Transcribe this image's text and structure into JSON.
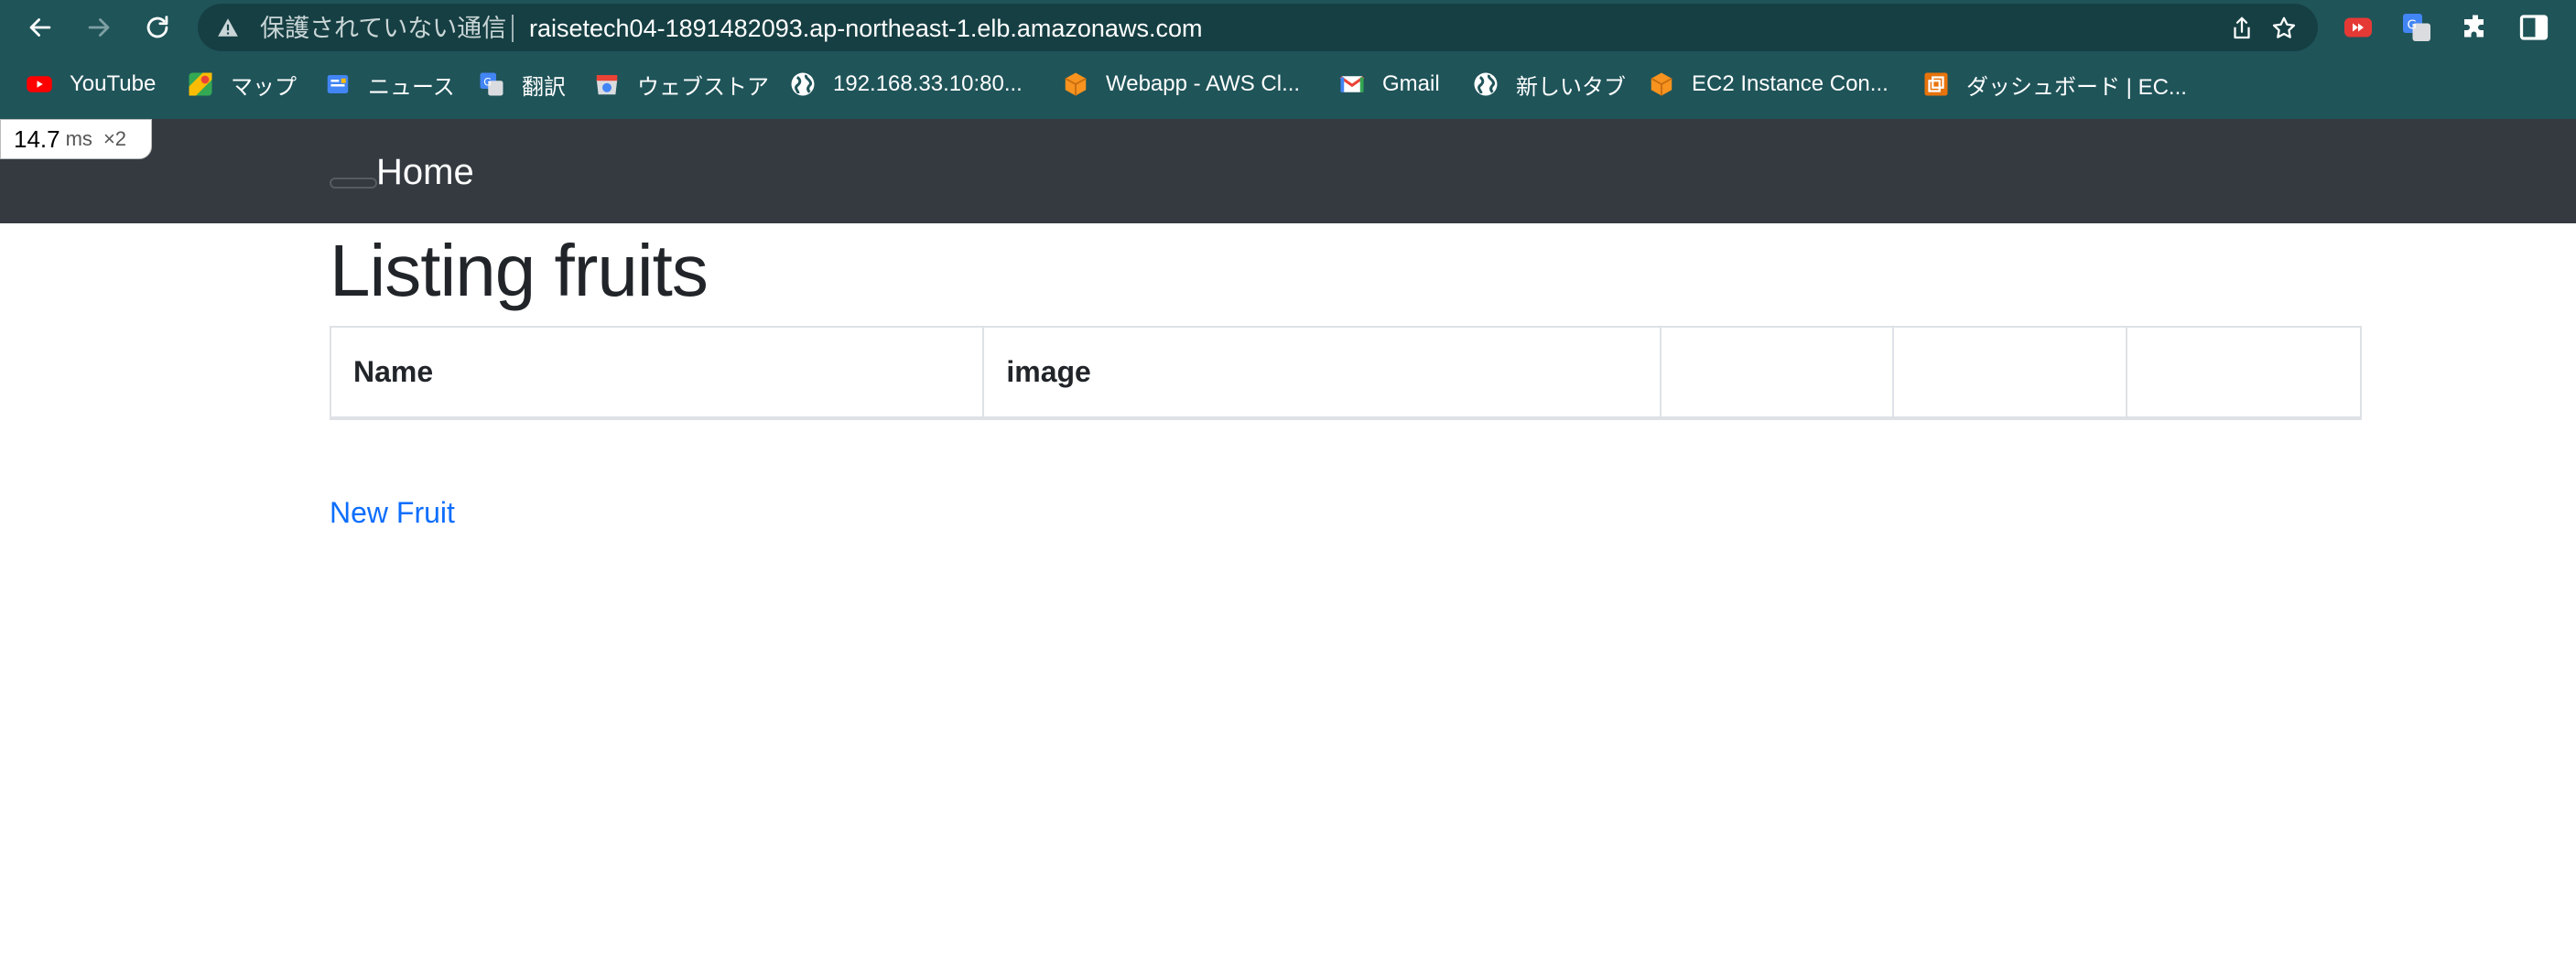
{
  "browser": {
    "security_label": "保護されていない通信",
    "url": "raisetech04-1891482093.ap-northeast-1.elb.amazonaws.com",
    "bookmarks": [
      {
        "label": "YouTube",
        "icon": "youtube-icon"
      },
      {
        "label": "マップ",
        "icon": "maps-icon"
      },
      {
        "label": "ニュース",
        "icon": "news-icon"
      },
      {
        "label": "翻訳",
        "icon": "translate-icon"
      },
      {
        "label": "ウェブストア",
        "icon": "webstore-icon"
      },
      {
        "label": "192.168.33.10:80...",
        "icon": "globe-icon"
      },
      {
        "label": "Webapp - AWS Cl...",
        "icon": "aws-cube-icon"
      },
      {
        "label": "Gmail",
        "icon": "gmail-icon"
      },
      {
        "label": "新しいタブ",
        "icon": "globe-icon"
      },
      {
        "label": "EC2 Instance Con...",
        "icon": "aws-cube-icon"
      },
      {
        "label": "ダッシュボード | EC...",
        "icon": "ec2-dashboard-icon"
      }
    ]
  },
  "perf_badge": {
    "value": "14.7",
    "unit": "ms",
    "multiplier": "×2"
  },
  "navbar": {
    "brand": "Home"
  },
  "main": {
    "title": "Listing fruits",
    "table": {
      "headers": [
        "Name",
        "image",
        "",
        "",
        ""
      ]
    },
    "new_link": "New Fruit"
  },
  "colors": {
    "browser_chrome": "#1f5459",
    "navbar": "#343a40",
    "link": "#0d6efd",
    "text": "#212529"
  }
}
